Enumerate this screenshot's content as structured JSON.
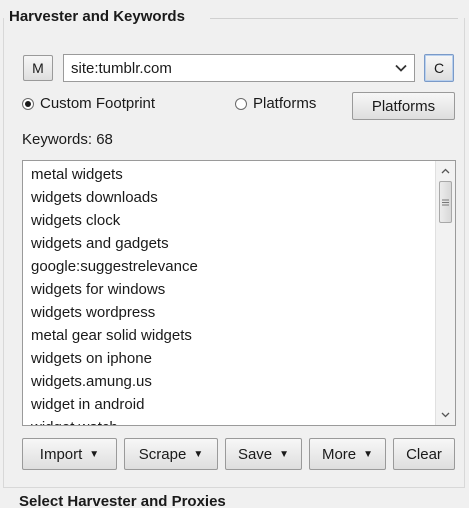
{
  "section_title": "Harvester and Keywords",
  "m_button": "M",
  "footprint_combo": {
    "value": "site:tumblr.com"
  },
  "c_button": "C",
  "radio": {
    "custom_footprint": "Custom Footprint",
    "platforms": "Platforms",
    "selected": "custom_footprint"
  },
  "platforms_button": "Platforms",
  "keywords_label": "Keywords:  68",
  "keywords": [
    "metal widgets",
    "widgets downloads",
    "widgets clock",
    "widgets and gadgets",
    "google:suggestrelevance",
    "widgets for windows",
    "widgets wordpress",
    "metal gear solid widgets",
    "widgets on iphone",
    "widgets.amung.us",
    "widget in android",
    "widget watch"
  ],
  "actions": {
    "import": "Import",
    "scrape": "Scrape",
    "save": "Save",
    "more": "More",
    "clear": "Clear"
  },
  "next_section_title": "Select Harvester and Proxies",
  "icons": {
    "combo_arrow": "chevron-down-icon",
    "scroll_up": "scroll-up-arrow-icon",
    "scroll_down": "scroll-down-arrow-icon",
    "dropdown_caret": "caret-down-icon"
  }
}
